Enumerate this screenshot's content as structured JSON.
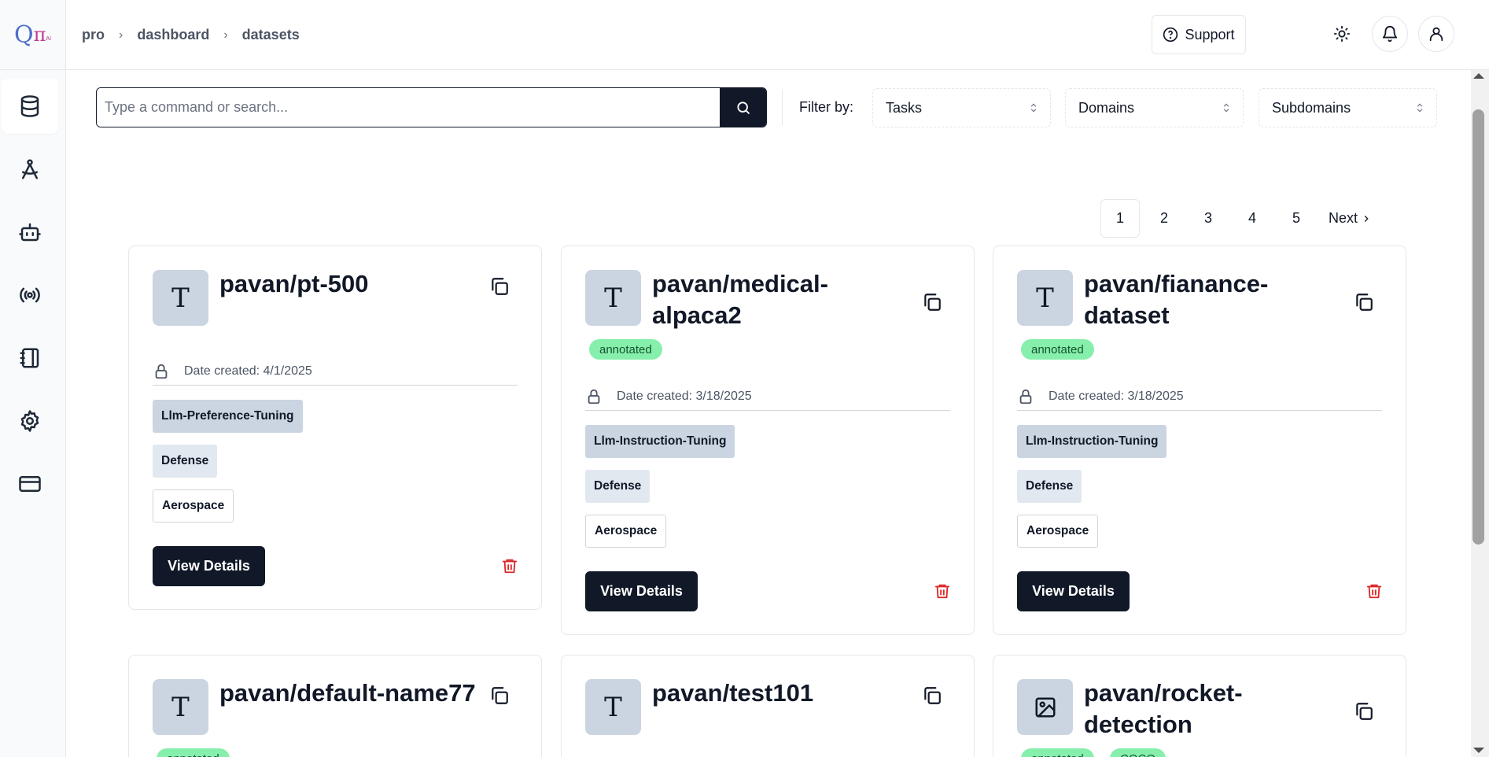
{
  "logo": {
    "q": "Q",
    "pi": "π",
    "ai": "AI"
  },
  "breadcrumb": {
    "items": [
      "pro",
      "dashboard",
      "datasets"
    ]
  },
  "header": {
    "support_label": "Support"
  },
  "search": {
    "placeholder": "Type a command or search..."
  },
  "filters": {
    "label": "Filter by:",
    "selects": [
      "Tasks",
      "Domains",
      "Subdomains"
    ]
  },
  "pagination": {
    "pages": [
      "1",
      "2",
      "3",
      "4",
      "5"
    ],
    "current": "1",
    "next_label": "Next"
  },
  "cards": [
    {
      "title": "pavan/pt-500",
      "avatar": "T",
      "icon": "text-type",
      "badges": [],
      "date": "Date created: 4/1/2025",
      "task": "Llm-Preference-Tuning",
      "domain": "Defense",
      "subdomain": "Aerospace",
      "button": "View Details"
    },
    {
      "title": "pavan/medical-alpaca2",
      "avatar": "T",
      "icon": "text-type",
      "badges": [
        "annotated"
      ],
      "date": "Date created: 3/18/2025",
      "task": "Llm-Instruction-Tuning",
      "domain": "Defense",
      "subdomain": "Aerospace",
      "button": "View Details"
    },
    {
      "title": "pavan/fianance-dataset",
      "avatar": "T",
      "icon": "text-type",
      "badges": [
        "annotated"
      ],
      "date": "Date created: 3/18/2025",
      "task": "Llm-Instruction-Tuning",
      "domain": "Defense",
      "subdomain": "Aerospace",
      "button": "View Details"
    },
    {
      "title": "pavan/default-name77",
      "avatar": "T",
      "icon": "text-type",
      "badges": [
        "annotated"
      ]
    },
    {
      "title": "pavan/test101",
      "avatar": "T",
      "icon": "text-type",
      "badges": []
    },
    {
      "title": "pavan/rocket-detection",
      "avatar": "",
      "icon": "image-type",
      "badges": [
        "annotated",
        "COCO"
      ]
    }
  ],
  "colors": {
    "primary": "#111827",
    "badge": "#86efac",
    "danger": "#dc2626",
    "avatar_bg": "#cbd5e1"
  }
}
